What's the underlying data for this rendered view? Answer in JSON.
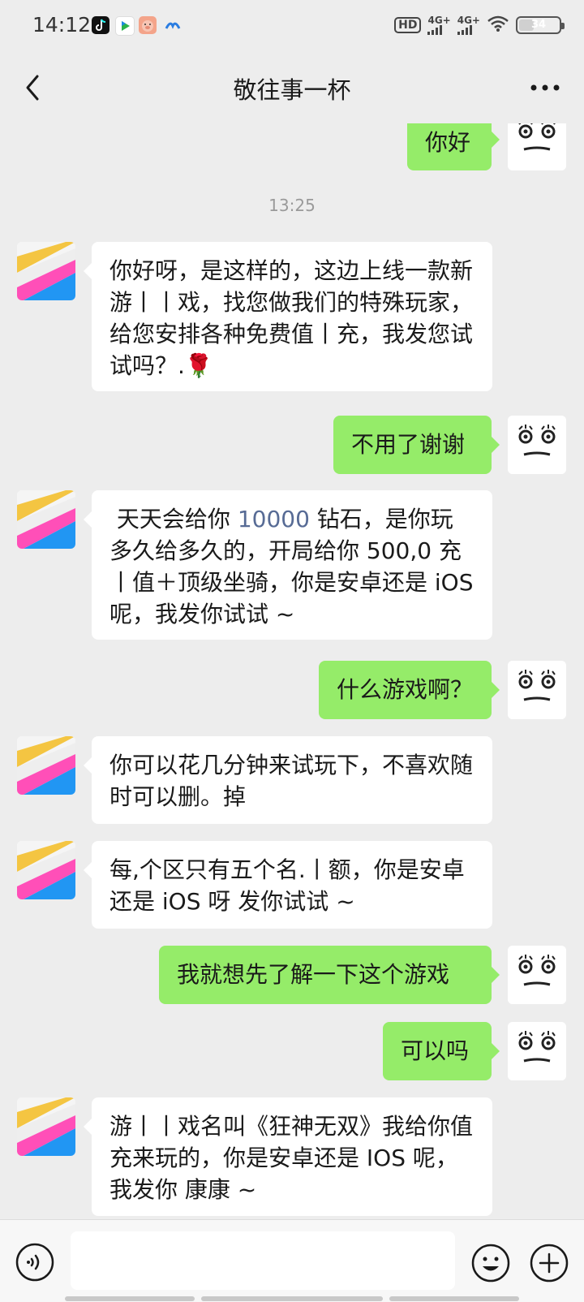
{
  "status_bar": {
    "time": "14:12",
    "hd": "HD",
    "signal_1": "4G+",
    "signal_2": "4G+",
    "battery_percent": "34",
    "app_icons": [
      "tiktok-icon",
      "video-app-icon",
      "pig-app-icon",
      "cloud-app-icon"
    ]
  },
  "header": {
    "title": "敬往事一杯",
    "back_icon": "chevron-left-icon",
    "more_icon": "more-dots-icon"
  },
  "colors": {
    "chat_bg": "#ededed",
    "bubble_out": "#95ec69",
    "bubble_in": "#ffffff",
    "link_blue": "#576b95"
  },
  "messages": [
    {
      "from": "me",
      "text": "你好"
    },
    {
      "type": "time",
      "text": "13:25"
    },
    {
      "from": "them",
      "text": "你好呀，是这样的，这边上线一款新  游丨丨戏，找您做我们的特殊玩家，给您安排各种免费值丨充，我发您试试吗？.🌹"
    },
    {
      "from": "me",
      "text": "不用了谢谢"
    },
    {
      "from": "them",
      "pre": " 天天会给你 ",
      "highlight": "10000",
      "post": " 钻石，是你玩多久给多久的，开局给你 500,0 充丨值＋顶级坐骑，你是安卓还是 iOS 呢，我发你试试 ~"
    },
    {
      "from": "me",
      "text": "什么游戏啊？"
    },
    {
      "from": "them",
      "text": "你可以花几分钟来试玩下，不喜欢随时可以删。掉"
    },
    {
      "from": "them",
      "text": "每,个区只有五个名.丨额，你是安卓还是 iOS 呀 发你试试 ~"
    },
    {
      "from": "me",
      "text": "我就想先了解一下这个游戏"
    },
    {
      "from": "me",
      "text": "可以吗"
    },
    {
      "from": "them",
      "text": "游丨丨戏名叫《狂神无双》我给你值充来玩的，你是安卓还是 IOS 呢，我发你  康康 ~"
    }
  ],
  "input_bar": {
    "placeholder": "",
    "voice_icon": "voice-icon",
    "emoji_icon": "emoji-icon",
    "plus_icon": "plus-circle-icon"
  }
}
